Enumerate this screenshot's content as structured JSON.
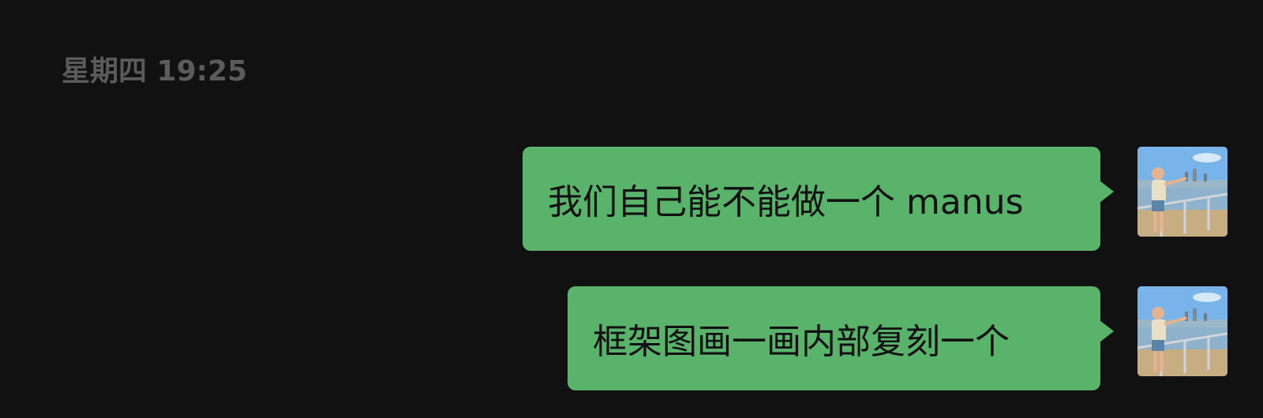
{
  "chat": {
    "timestamp": "星期四 19:25",
    "messages": [
      {
        "text": "我们自己能不能做一个 manus",
        "sender": "self"
      },
      {
        "text": "框架图画一画内部复刻一个",
        "sender": "self"
      }
    ]
  },
  "colors": {
    "background": "#111111",
    "timestamp": "#5b5b5b",
    "bubble": "#59b36b",
    "bubble_text": "#111111"
  },
  "icons": {
    "avatar": "user-avatar-photo"
  }
}
